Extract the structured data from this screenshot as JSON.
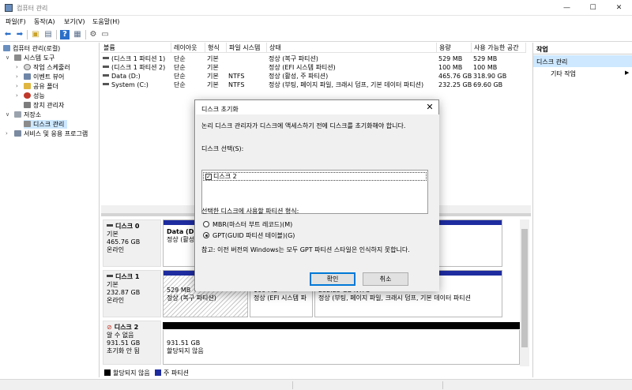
{
  "window": {
    "title": "컴퓨터 관리",
    "controls": {
      "minimize": "—",
      "maximize": "☐",
      "close": "✕"
    }
  },
  "menu": [
    "파일(F)",
    "동작(A)",
    "보기(V)",
    "도움말(H)"
  ],
  "toolbar": {
    "icons": [
      "back-arrow-icon",
      "forward-arrow-icon",
      "up-folder-icon",
      "show-hide-tree-icon",
      "help-icon",
      "properties-icon",
      "settings-icon",
      "view-icon"
    ],
    "glyphs": {
      "back": "⬅",
      "forward": "➡",
      "up": "▣",
      "tree": "▤",
      "help": "?",
      "props": "▦",
      "settings": "⚙",
      "view": "▭"
    }
  },
  "tree": {
    "root": "컴퓨터 관리(로컬)",
    "system_tools": "시스템 도구",
    "task_scheduler": "작업 스케줄러",
    "event_viewer": "이벤트 뷰어",
    "shared_folders": "공유 폴더",
    "performance": "성능",
    "device_manager": "장치 관리자",
    "storage": "저장소",
    "disk_management": "디스크 관리",
    "services_apps": "서비스 및 응용 프로그램",
    "expand_open": "∨",
    "expand_closed": "›"
  },
  "volume_list": {
    "columns": [
      "볼륨",
      "레이아웃",
      "형식",
      "파일 시스템",
      "상태",
      "용량",
      "사용 가능한 공간"
    ],
    "rows": [
      {
        "volume": "(디스크 1 파티션 1)",
        "layout": "단순",
        "type": "기본",
        "fs": "",
        "status": "정상 (복구 파티션)",
        "capacity": "529 MB",
        "free": "529 MB"
      },
      {
        "volume": "(디스크 1 파티션 2)",
        "layout": "단순",
        "type": "기본",
        "fs": "",
        "status": "정상 (EFI 시스템 파티션)",
        "capacity": "100 MB",
        "free": "100 MB"
      },
      {
        "volume": "Data (D:)",
        "layout": "단순",
        "type": "기본",
        "fs": "NTFS",
        "status": "정상 (활성, 주 파티션)",
        "capacity": "465.76 GB",
        "free": "318.90 GB"
      },
      {
        "volume": "System (C:)",
        "layout": "단순",
        "type": "기본",
        "fs": "NTFS",
        "status": "정상 (부팅, 페이지 파일, 크래시 덤프, 기본 데이터 파티션)",
        "capacity": "232.25 GB",
        "free": "69.60 GB"
      }
    ]
  },
  "disks": [
    {
      "name": "디스크 0",
      "type": "기본",
      "size": "465.76 GB",
      "state": "온라인",
      "partitions": [
        {
          "title": "Data  (D:)",
          "status": "정상 (활성"
        }
      ]
    },
    {
      "name": "디스크 1",
      "type": "기본",
      "size": "232.87 GB",
      "state": "온라인",
      "partitions": [
        {
          "title": "529 MB",
          "status": "정상 (복구 파티션)"
        },
        {
          "title": "100 MB",
          "status": "정상 (EFI 시스템 파"
        },
        {
          "title": "232.25 GB NTFS",
          "status": "정상 (부팅, 페이지 파일, 크래시 덤프, 기본 데이터 파티션"
        }
      ]
    },
    {
      "name": "디스크 2",
      "type": "알 수 없음",
      "size": "931.51 GB",
      "state": "초기화 안 됨",
      "partitions": [
        {
          "title": "931.51 GB",
          "status": "할당되지 않음"
        }
      ]
    }
  ],
  "legend": [
    {
      "label": "할당되지 않음",
      "color": "#000000"
    },
    {
      "label": "주 파티션",
      "color": "#1e2ca0"
    }
  ],
  "actions": {
    "header": "작업",
    "section": "디스크 관리",
    "item": "기타 작업",
    "arrow": "▶"
  },
  "dialog": {
    "title": "디스크 초기화",
    "close": "✕",
    "intro": "논리 디스크 관리자가 디스크에 액세스하기 전에 디스크를 초기화해야 합니다.",
    "select_label": "디스크 선택(S):",
    "disk_item": "디스크 2",
    "disk_checked": true,
    "check_mark": "✓",
    "style_label": "선택한 디스크에 사용할 파티션 형식:",
    "option_mbr": "MBR(마스터 부트 레코드)(M)",
    "option_gpt": "GPT(GUID 파티션 테이블)(G)",
    "selected_style": "GPT",
    "note": "참고: 이전 버전의 Windows는 모두 GPT 파티션 스타일은 인식하지 못합니다.",
    "ok": "확인",
    "cancel": "취소"
  }
}
